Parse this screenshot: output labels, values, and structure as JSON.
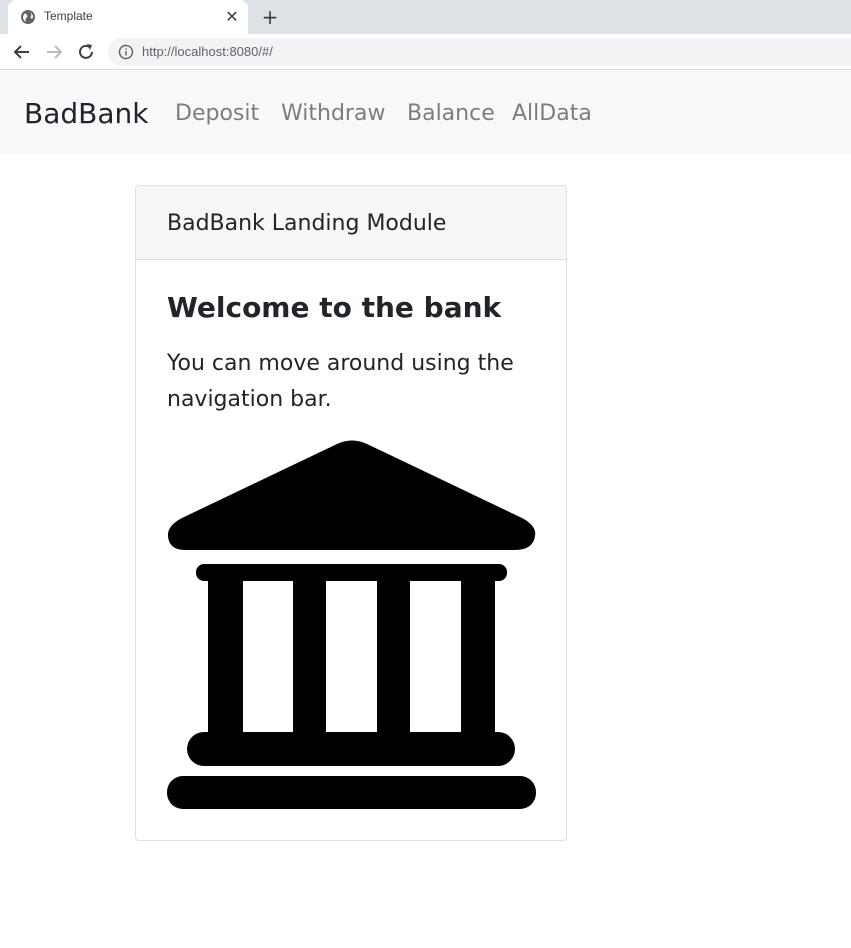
{
  "browser": {
    "tab_title": "Template",
    "url": "http://localhost:8080/#/",
    "new_tab_label": "+",
    "close_label": "✕"
  },
  "navbar": {
    "brand": "BadBank",
    "links": [
      {
        "label": "Deposit"
      },
      {
        "label": "Withdraw"
      },
      {
        "label": "Balance"
      },
      {
        "label": "AllData"
      }
    ]
  },
  "card": {
    "header": "BadBank Landing Module",
    "title": "Welcome to the bank",
    "text": "You can move around using the navigation bar.",
    "image_icon": "bank-building-icon"
  },
  "colors": {
    "navbar_bg": "#f8f9fa",
    "card_header_bg": "#f7f7f7",
    "text": "#212529",
    "nav_link": "rgba(0,0,0,0.5)"
  }
}
